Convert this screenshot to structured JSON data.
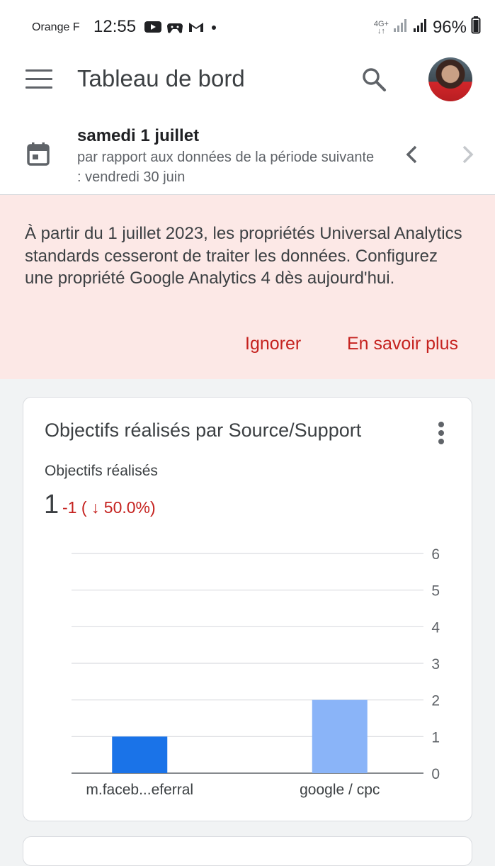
{
  "status_bar": {
    "carrier": "Orange F",
    "time": "12:55",
    "network": "4G+",
    "battery": "96%"
  },
  "app_bar": {
    "title": "Tableau de bord"
  },
  "date_bar": {
    "date": "samedi 1 juillet",
    "comparison": "par rapport aux données de la période suivante : vendredi 30 juin"
  },
  "banner": {
    "message": "À partir du 1 juillet 2023, les propriétés Universal Analytics standards cesseront de traiter les données. Configurez une propriété Google Analytics 4 dès aujourd'hui.",
    "ignore_label": "Ignorer",
    "learn_more_label": "En savoir plus"
  },
  "card": {
    "title": "Objectifs réalisés par Source/Support",
    "metric_label": "Objectifs réalisés",
    "metric_value": "1",
    "metric_change": "-1 ( ↓ 50.0%)"
  },
  "chart_data": {
    "type": "bar",
    "categories": [
      "m.faceb...eferral",
      "google / cpc"
    ],
    "values": [
      1,
      2
    ],
    "bar_colors": [
      "#1a73e8",
      "#8ab4f8"
    ],
    "ylim": [
      0,
      6
    ],
    "yticks": [
      "0",
      "1",
      "2",
      "3",
      "4",
      "5",
      "6"
    ],
    "grid": true,
    "y_axis_side": "right"
  }
}
